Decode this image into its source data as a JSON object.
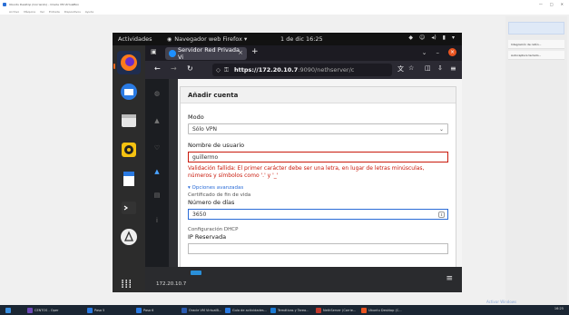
{
  "host": {
    "window_title": "Ubuntu Desktop (Corriendo) - Oracle VM VirtualBox",
    "menu": [
      "Archivo",
      "Máquina",
      "Ver",
      "Entrada",
      "Dispositivos",
      "Ayuda"
    ],
    "controls": [
      "—",
      "□",
      "✕"
    ],
    "side_panel_rows": [
      "Integración de ratón...",
      "Autocaptura teclado..."
    ]
  },
  "gnome": {
    "activities": "Actividades",
    "app_name": "Navegador web Firefox ▾",
    "clock": "1 de dic  16:25"
  },
  "firefox": {
    "tab_title": "Servidor Red Privada Vi",
    "url_host": "https://172.20.10.7",
    "url_rest": ":9090/nethserver/c"
  },
  "dialog": {
    "title": "Añadir cuenta",
    "mode_label": "Modo",
    "mode_value": "Sólo VPN",
    "user_label": "Nombre de usuario",
    "user_value": "guillermo",
    "error": "Validación fallida: El primer carácter debe ser una letra, en lugar de letras minúsculas, números y símbolos como '.' y '_'",
    "advanced_link": "▾ Opciones avanzadas",
    "cert_label": "Certificado de fin de vida",
    "days_label": "Número de días",
    "days_value": "3650",
    "dhcp_label": "Configuración DHCP",
    "ip_label": "IP Reservada"
  },
  "vm_bottom": {
    "ip": "172.20.10.7"
  },
  "taskbar": {
    "items": [
      "CENTOS - Oper",
      "Paso 5",
      "Paso 6",
      "Oracle VM VirtualB...",
      "Guía de actividades...",
      "Temáticas y Tarea...",
      "NethServer (Corrie...",
      "Ubuntu Desktop (C..."
    ],
    "clock": "16:25",
    "watermark": "Activar Windows"
  }
}
